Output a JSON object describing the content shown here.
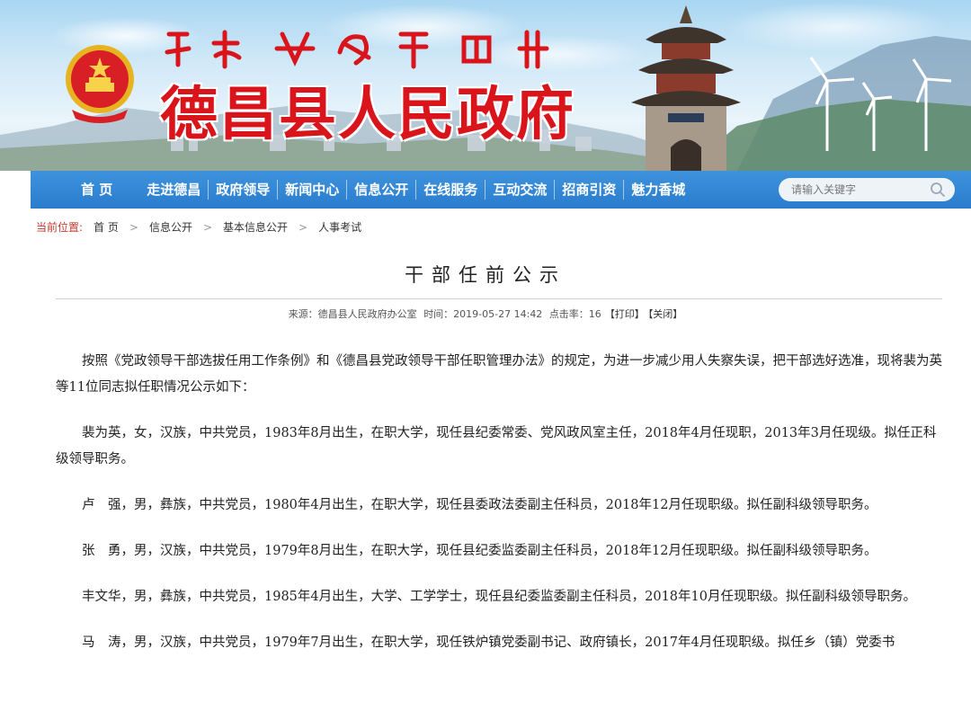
{
  "header": {
    "site_title": "德昌县人民政府",
    "logo": "national-emblem"
  },
  "nav": {
    "items": [
      {
        "label": "首  页"
      },
      {
        "label": "走进德昌"
      },
      {
        "label": "政府领导"
      },
      {
        "label": "新闻中心"
      },
      {
        "label": "信息公开"
      },
      {
        "label": "在线服务"
      },
      {
        "label": "互动交流"
      },
      {
        "label": "招商引资"
      },
      {
        "label": "魅力香城"
      }
    ],
    "search_placeholder": "请输入关键字",
    "search_icon": "search-icon"
  },
  "breadcrumb": {
    "label": "当前位置:",
    "items": [
      "首 页",
      "信息公开",
      "基本信息公开",
      "人事考试"
    ],
    "separator": ">"
  },
  "article": {
    "title": "干部任前公示",
    "meta": {
      "source": "来源：德昌县人民政府办公室",
      "time": "时间：2019-05-27 14:42",
      "clicks": "点击率：16",
      "print": "【打印】",
      "close": "【关闭】"
    },
    "paragraphs": [
      "按照《党政领导干部选拔任用工作条例》和《德昌县党政领导干部任职管理办法》的规定，为进一步减少用人失察失误，把干部选好选准，现将裴为英等11位同志拟任职情况公示如下：",
      "裴为英，女，汉族，中共党员，1983年8月出生，在职大学，现任县纪委常委、党风政风室主任，2018年4月任现职，2013年3月任现级。拟任正科级领导职务。",
      "卢　强，男，彝族，中共党员，1980年4月出生，在职大学，现任县委政法委副主任科员，2018年12月任现职级。拟任副科级领导职务。",
      "张　勇，男，汉族，中共党员，1979年8月出生，在职大学，现任县纪委监委副主任科员，2018年12月任现职级。拟任副科级领导职务。",
      "丰文华，男，彝族，中共党员，1985年4月出生，大学、工学学士，现任县纪委监委副主任科员，2018年10月任现职级。拟任副科级领导职务。",
      "马　涛，男，汉族，中共党员，1979年7月出生，在职大学，现任铁炉镇党委副书记、政府镇长，2017年4月任现职级。拟任乡（镇）党委书"
    ]
  },
  "colors": {
    "nav_bg": "#2a7ccd",
    "title_red": "#d9141b",
    "breadcrumb_label": "#c0392b"
  }
}
